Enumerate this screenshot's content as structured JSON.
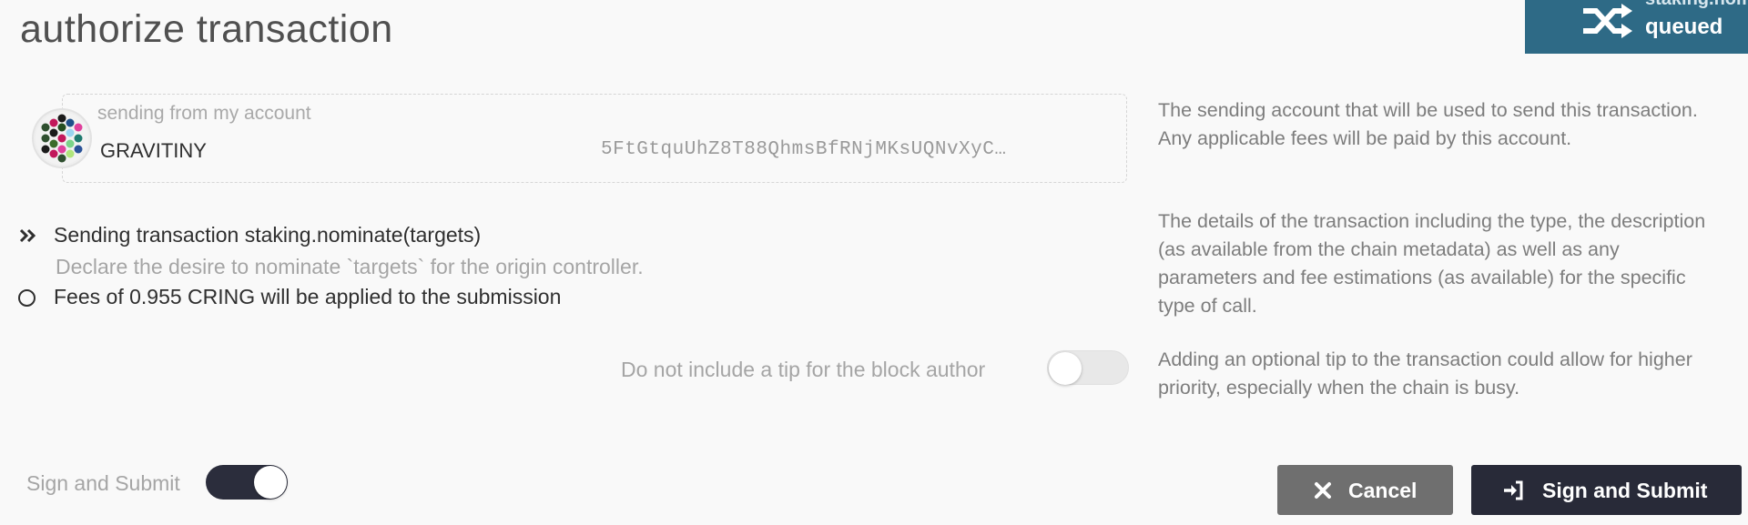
{
  "modal": {
    "title": "authorize transaction"
  },
  "toast": {
    "method": "staking.nominate",
    "status": "queued",
    "icon": "shuffle-icon",
    "bg_color": "#2e6a86"
  },
  "account": {
    "label": "sending from my account",
    "name": "GRAVITINY",
    "address": "5FtGtquUhZ8T88QhmsBfRNjMKsUQNvXyC…",
    "icon": "identicon"
  },
  "transaction": {
    "summary": "Sending transaction staking.nominate(targets)",
    "description": "Declare the desire to nominate `targets` for the origin controller.",
    "fees": "Fees of 0.955 CRING will be applied to the submission",
    "icon": "double-chevron-right-icon"
  },
  "tip": {
    "label": "Do not include a tip for the block author",
    "enabled": false
  },
  "help": {
    "account": "The sending account that will be used to send this transaction. Any applicable fees will be paid by this account.",
    "details": "The details of the transaction including the type, the description (as available from the chain metadata) as well as any parameters and fee estimations (as available) for the specific type of call.",
    "tip": "Adding an optional tip to the transaction could allow for higher priority, especially when the chain is busy."
  },
  "sign": {
    "label": "Sign and Submit",
    "enabled": true
  },
  "buttons": {
    "cancel": "Cancel",
    "submit": "Sign and Submit",
    "cancel_color": "#6f6f6f",
    "submit_color": "#282a38"
  }
}
